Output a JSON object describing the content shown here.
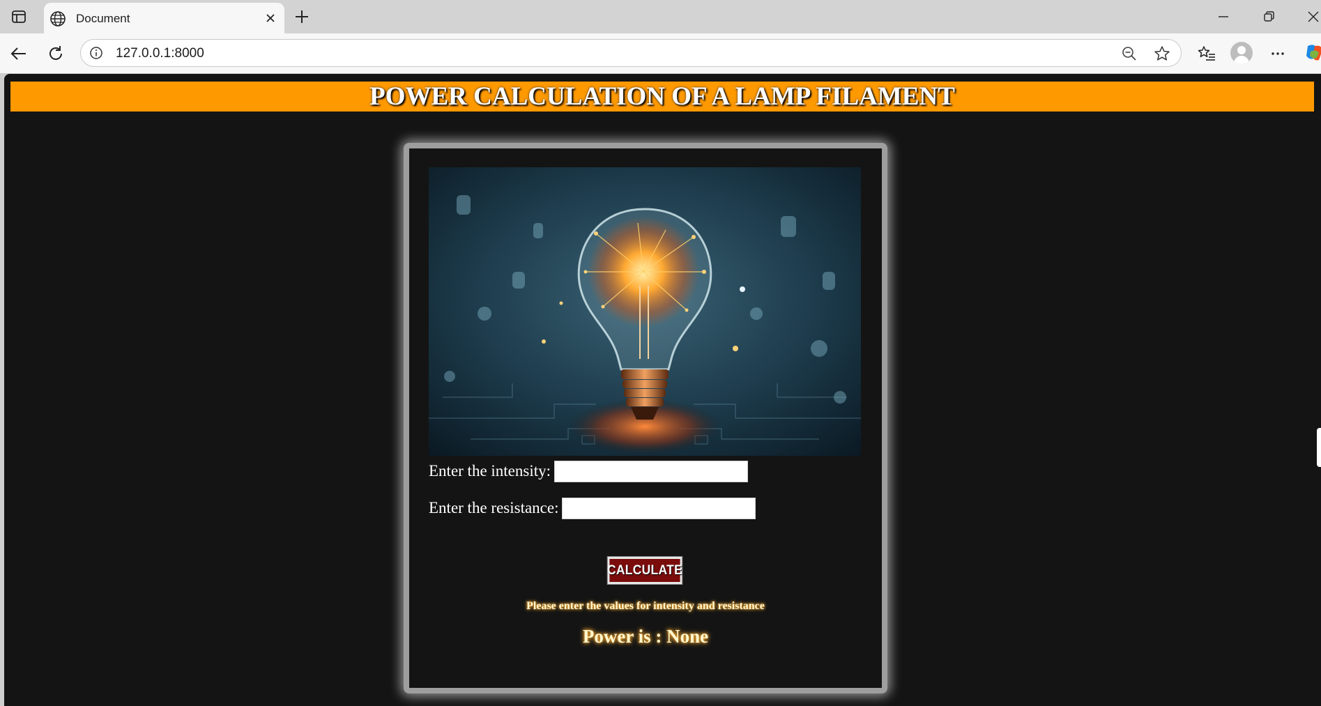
{
  "browser": {
    "tab_title": "Document",
    "url": "127.0.0.1:8000",
    "icons": {
      "tab_actions": "tab-actions-icon",
      "tab_site": "globe-icon",
      "tab_close": "close-icon",
      "new_tab": "plus-icon",
      "minimize": "minimize-icon",
      "restore": "restore-icon",
      "close_window": "close-icon",
      "back": "back-arrow-icon",
      "refresh": "refresh-icon",
      "site_info": "info-icon",
      "zoom": "zoom-out-icon",
      "favorite": "star-icon",
      "favorites": "favorites-icon",
      "profile": "profile-avatar-icon",
      "menu": "more-icon",
      "copilot": "copilot-icon"
    }
  },
  "page": {
    "title": "POWER CALCULATION OF A LAMP FILAMENT",
    "colors": {
      "banner": "#ff9900",
      "background": "#141414",
      "button": "#7a0c0c"
    },
    "form": {
      "intensity_label": "Enter the intensity:",
      "intensity_value": "",
      "resistance_label": "Enter the resistance:",
      "resistance_value": "",
      "button_label": "CALCULATE"
    },
    "message": "Please enter the values for intensity and resistance",
    "result": "Power is : None"
  }
}
